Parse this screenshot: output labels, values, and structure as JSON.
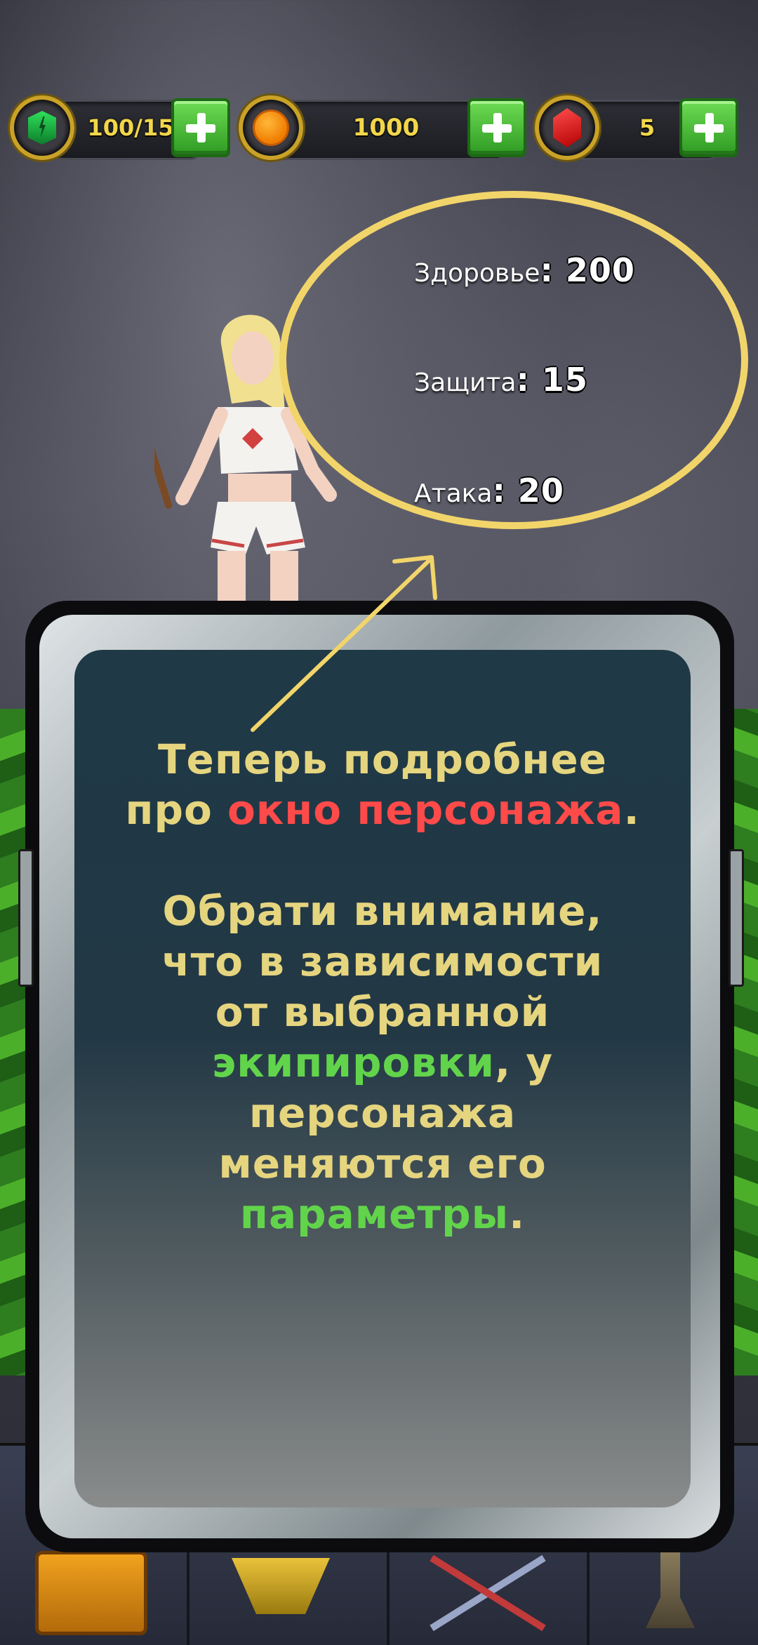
{
  "resources": {
    "energy": {
      "value": "100/15",
      "icon": "energy-icon"
    },
    "coins": {
      "value": "1000",
      "icon": "coin-icon"
    },
    "gems": {
      "value": "5",
      "icon": "ruby-gem-icon"
    }
  },
  "stats": [
    {
      "label": "Здоровье",
      "value": "200"
    },
    {
      "label": "Защита",
      "value": "15"
    },
    {
      "label": "Атака",
      "value": "20"
    }
  ],
  "tutorial": {
    "p1_a": "Теперь подробнее про ",
    "p1_b": "окно персонажа",
    "p1_c": ".",
    "p2_a": "Обрати внимание, что в зависимости от выбранной ",
    "p2_b": "экипировки",
    "p2_c": ", у персонажа меняются его ",
    "p2_d": "параметры",
    "p2_e": "."
  },
  "colors": {
    "accent_yellow": "#f2d56a",
    "text_yellow": "#e5d57f",
    "highlight_red": "#ff4a4a",
    "highlight_green": "#62d44b",
    "plus_green": "#4cbf37"
  },
  "bottom_nav": [
    "chest-icon",
    "shop-icon",
    "battle-swords-icon",
    "forge-anvil-icon"
  ]
}
